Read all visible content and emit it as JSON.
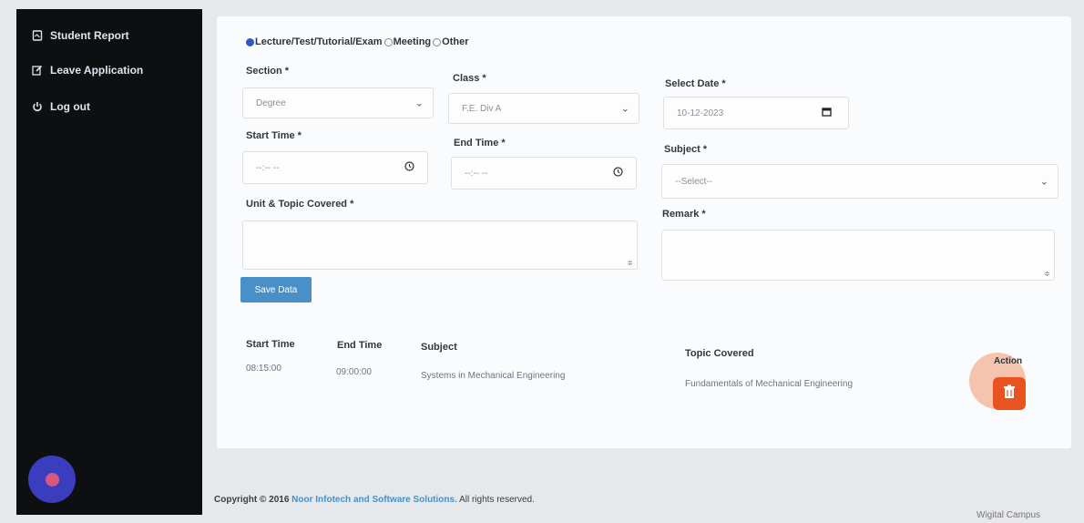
{
  "sidebar": {
    "items": [
      {
        "label": "Student Report",
        "icon": "report-icon"
      },
      {
        "label": "Leave Application",
        "icon": "edit-icon"
      },
      {
        "label": "Log out",
        "icon": "power-icon"
      }
    ]
  },
  "form": {
    "types": [
      {
        "label": "Lecture/Test/Tutorial/Exam",
        "selected": true
      },
      {
        "label": "Meeting",
        "selected": false
      },
      {
        "label": "Other",
        "selected": false
      }
    ],
    "section": {
      "label": "Section *",
      "value": "Degree"
    },
    "class": {
      "label": "Class *",
      "value": "F.E. Div A"
    },
    "date": {
      "label": "Select Date *",
      "value": "10-12-2023"
    },
    "start_time": {
      "label": "Start Time *",
      "value": "--:-- --"
    },
    "end_time": {
      "label": "End Time *",
      "value": "--:-- --"
    },
    "subject": {
      "label": "Subject *",
      "value": "--Select--"
    },
    "unit_topic": {
      "label": "Unit & Topic Covered *",
      "value": ""
    },
    "remark": {
      "label": "Remark *",
      "value": ""
    },
    "save_label": "Save Data"
  },
  "table": {
    "headers": {
      "start": "Start Time",
      "end": "End Time",
      "subject": "Subject",
      "topic": "Topic Covered",
      "action": "Action"
    },
    "rows": [
      {
        "start": "08:15:00",
        "end": "09:00:00",
        "subject": "Systems in Mechanical Engineering",
        "topic": "Fundamentals of Mechanical Engineering"
      }
    ]
  },
  "footer": {
    "prefix": "Copyright © 2016 ",
    "company": "Noor Infotech and Software Solutions.",
    "suffix": " All rights reserved.",
    "brand": "Wigital Campus"
  },
  "colors": {
    "accent": "#4a90c8",
    "danger": "#e8531f",
    "sidebar": "#0d0f11"
  }
}
